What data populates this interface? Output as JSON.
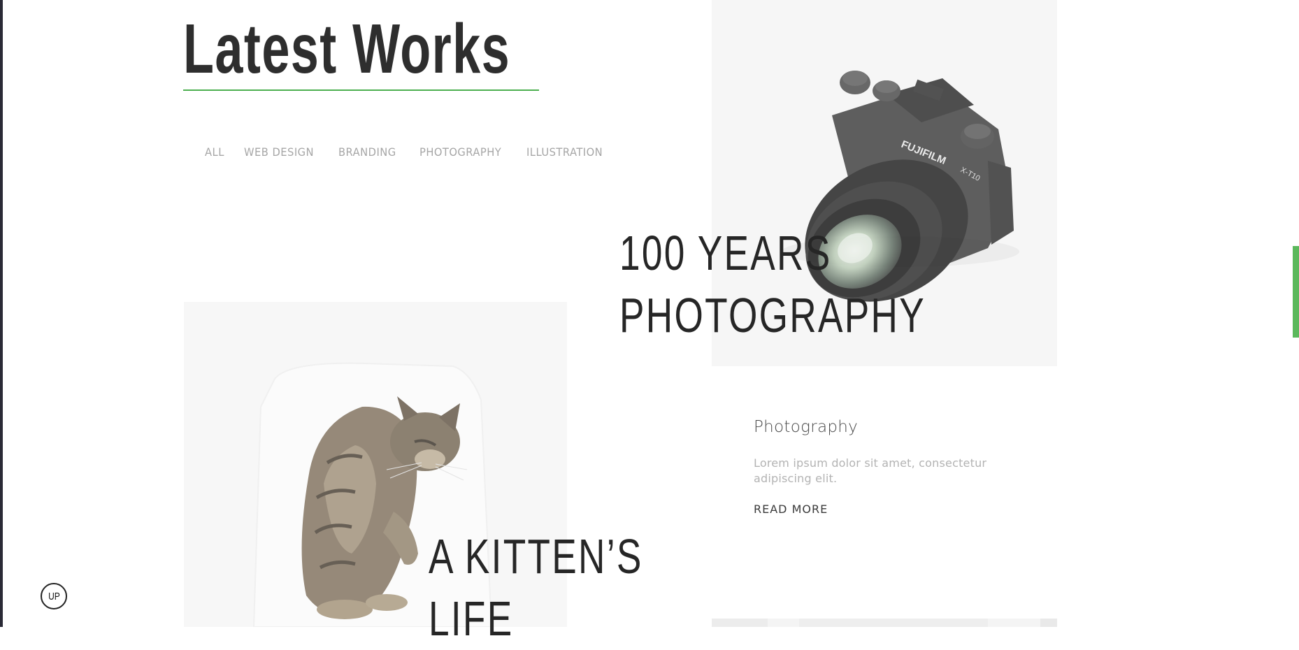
{
  "page": {
    "title": "Latest Works"
  },
  "filters": [
    {
      "label": "ALL"
    },
    {
      "label": "WEB DESIGN"
    },
    {
      "label": "BRANDING"
    },
    {
      "label": "PHOTOGRAPHY"
    },
    {
      "label": "ILLUSTRATION"
    }
  ],
  "works": [
    {
      "title_line1": "100 YEARS",
      "title_line2": "PHOTOGRAPHY",
      "category": "Photography",
      "description": "Lorem ipsum dolor sit amet, consectetur adipiscing elit.",
      "read_more": "READ MORE",
      "image": "camera-photo"
    },
    {
      "title_line1": "A KITTEN’S",
      "title_line2": "LIFE",
      "image": "kitten-photo"
    }
  ],
  "scroll_top": {
    "label": "UP"
  },
  "colors": {
    "accent": "#4caf50",
    "title": "#2e2e2e",
    "filter_text": "#a6a6a6",
    "muted_text": "#b3b3b3"
  }
}
